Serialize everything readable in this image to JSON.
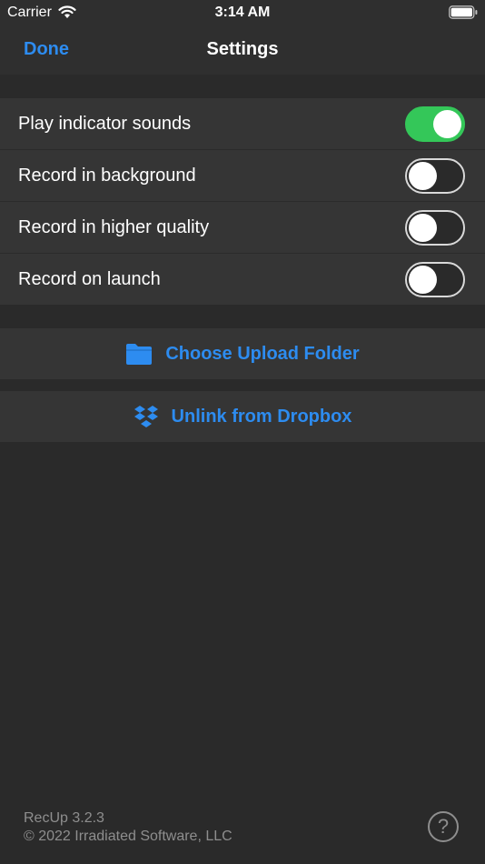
{
  "status_bar": {
    "carrier": "Carrier",
    "time": "3:14 AM",
    "icons": [
      "wifi-icon",
      "battery-icon"
    ]
  },
  "nav": {
    "done_label": "Done",
    "title": "Settings"
  },
  "settings": {
    "toggles": [
      {
        "label": "Play indicator sounds",
        "on": true
      },
      {
        "label": "Record in background",
        "on": false
      },
      {
        "label": "Record in higher quality",
        "on": false
      },
      {
        "label": "Record on launch",
        "on": false
      }
    ]
  },
  "actions": {
    "choose_folder": {
      "label": "Choose Upload Folder",
      "icon": "folder-icon"
    },
    "unlink_dropbox": {
      "label": "Unlink from Dropbox",
      "icon": "dropbox-icon"
    }
  },
  "footer": {
    "version": "RecUp 3.2.3",
    "copyright": "© 2022 Irradiated Software, LLC",
    "help_label": "?"
  },
  "colors": {
    "accent": "#2d8cf0",
    "toggle_on": "#34c759",
    "background": "#2a2a2a",
    "row_background": "#353535"
  }
}
